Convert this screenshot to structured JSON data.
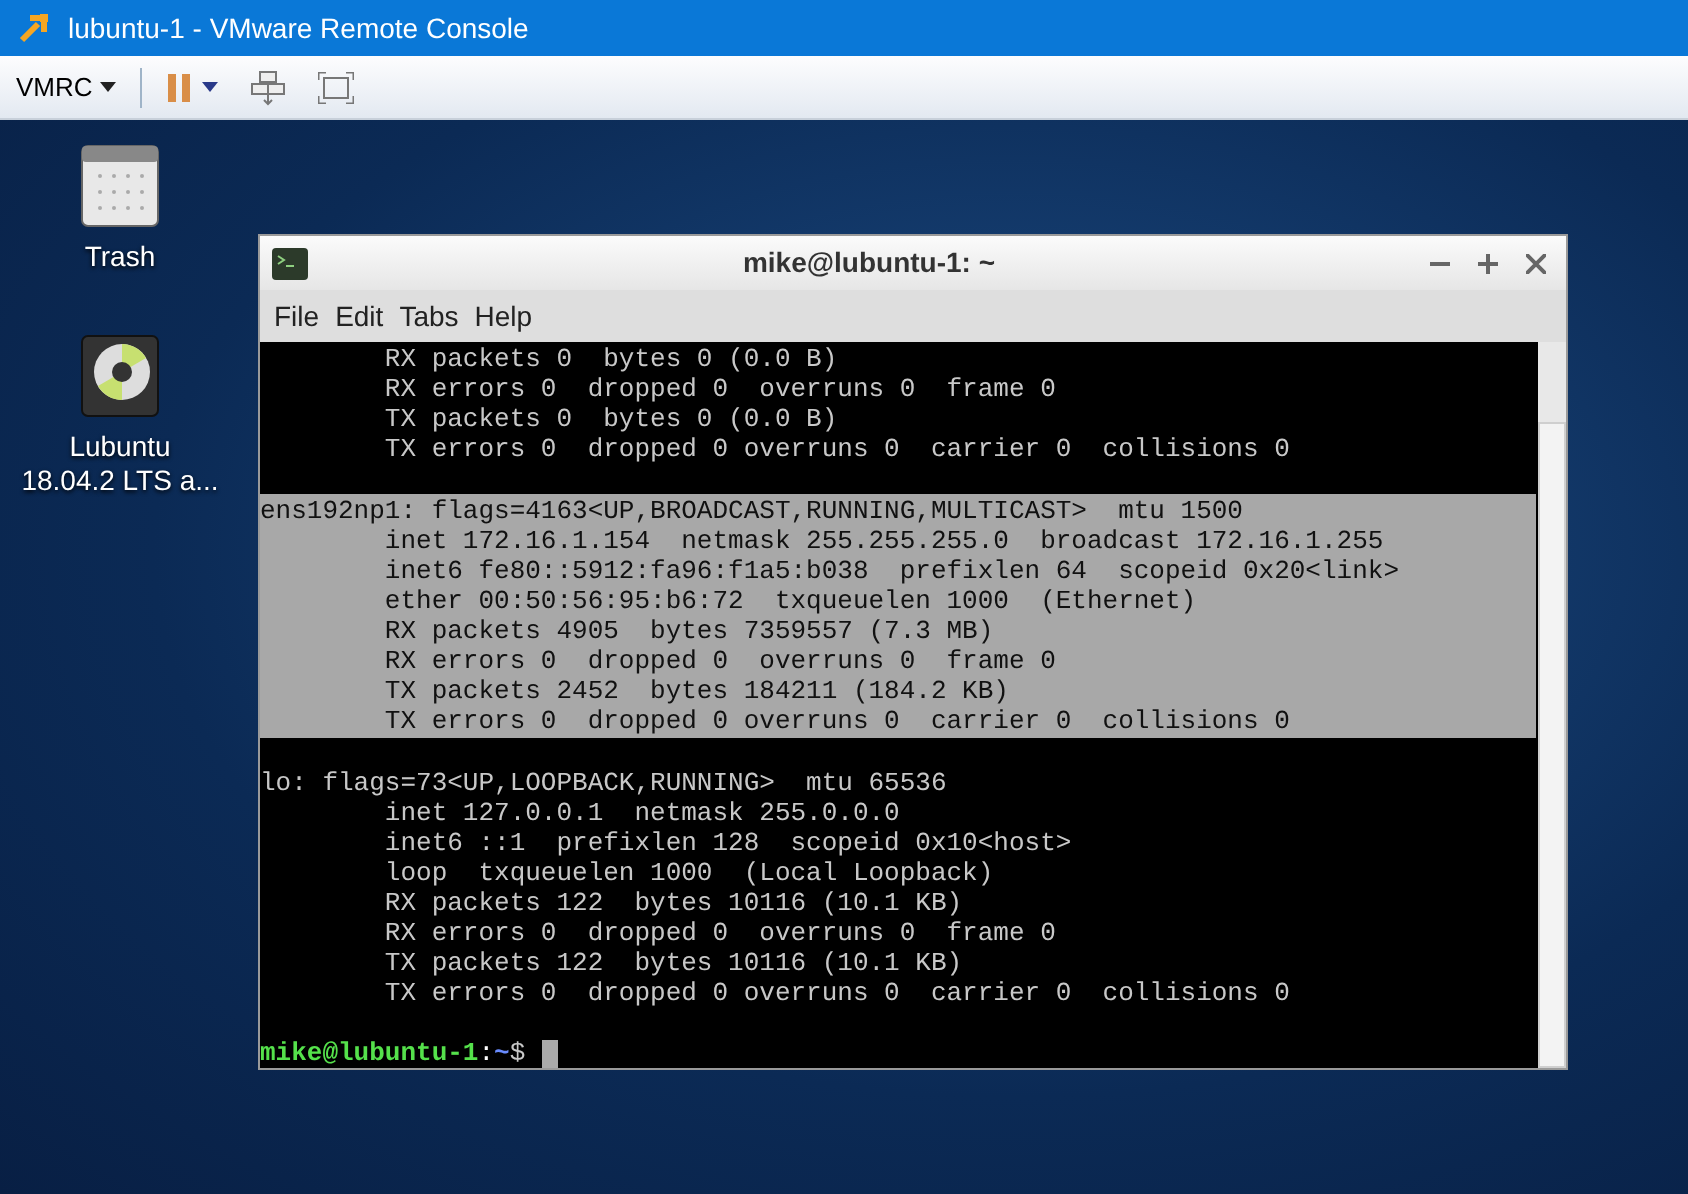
{
  "window": {
    "title": "lubuntu-1 - VMware Remote Console"
  },
  "toolbar": {
    "menu_label": "VMRC"
  },
  "desktop_icons": [
    {
      "kind": "trash",
      "label": "Trash"
    },
    {
      "kind": "disc",
      "label": "Lubuntu\n18.04.2 LTS a..."
    }
  ],
  "terminal": {
    "title": "mike@lubuntu-1: ~",
    "menu": [
      "File",
      "Edit",
      "Tabs",
      "Help"
    ],
    "blocks": [
      {
        "selected": false,
        "lines": [
          "        RX packets 0  bytes 0 (0.0 B)",
          "        RX errors 0  dropped 0  overruns 0  frame 0",
          "        TX packets 0  bytes 0 (0.0 B)",
          "        TX errors 0  dropped 0 overruns 0  carrier 0  collisions 0"
        ]
      },
      {
        "selected": true,
        "lines": [
          "ens192np1: flags=4163<UP,BROADCAST,RUNNING,MULTICAST>  mtu 1500",
          "        inet 172.16.1.154  netmask 255.255.255.0  broadcast 172.16.1.255",
          "        inet6 fe80::5912:fa96:f1a5:b038  prefixlen 64  scopeid 0x20<link>",
          "        ether 00:50:56:95:b6:72  txqueuelen 1000  (Ethernet)",
          "        RX packets 4905  bytes 7359557 (7.3 MB)",
          "        RX errors 0  dropped 0  overruns 0  frame 0",
          "        TX packets 2452  bytes 184211 (184.2 KB)",
          "        TX errors 0  dropped 0 overruns 0  carrier 0  collisions 0"
        ]
      },
      {
        "selected": false,
        "lines": [
          "lo: flags=73<UP,LOOPBACK,RUNNING>  mtu 65536",
          "        inet 127.0.0.1  netmask 255.0.0.0",
          "        inet6 ::1  prefixlen 128  scopeid 0x10<host>",
          "        loop  txqueuelen 1000  (Local Loopback)",
          "        RX packets 122  bytes 10116 (10.1 KB)",
          "        RX errors 0  dropped 0  overruns 0  frame 0",
          "        TX packets 122  bytes 10116 (10.1 KB)",
          "        TX errors 0  dropped 0 overruns 0  carrier 0  collisions 0"
        ]
      }
    ],
    "prompt": {
      "user_host": "mike@lubuntu-1",
      "separator": ":",
      "path": "~",
      "symbol": "$"
    }
  }
}
